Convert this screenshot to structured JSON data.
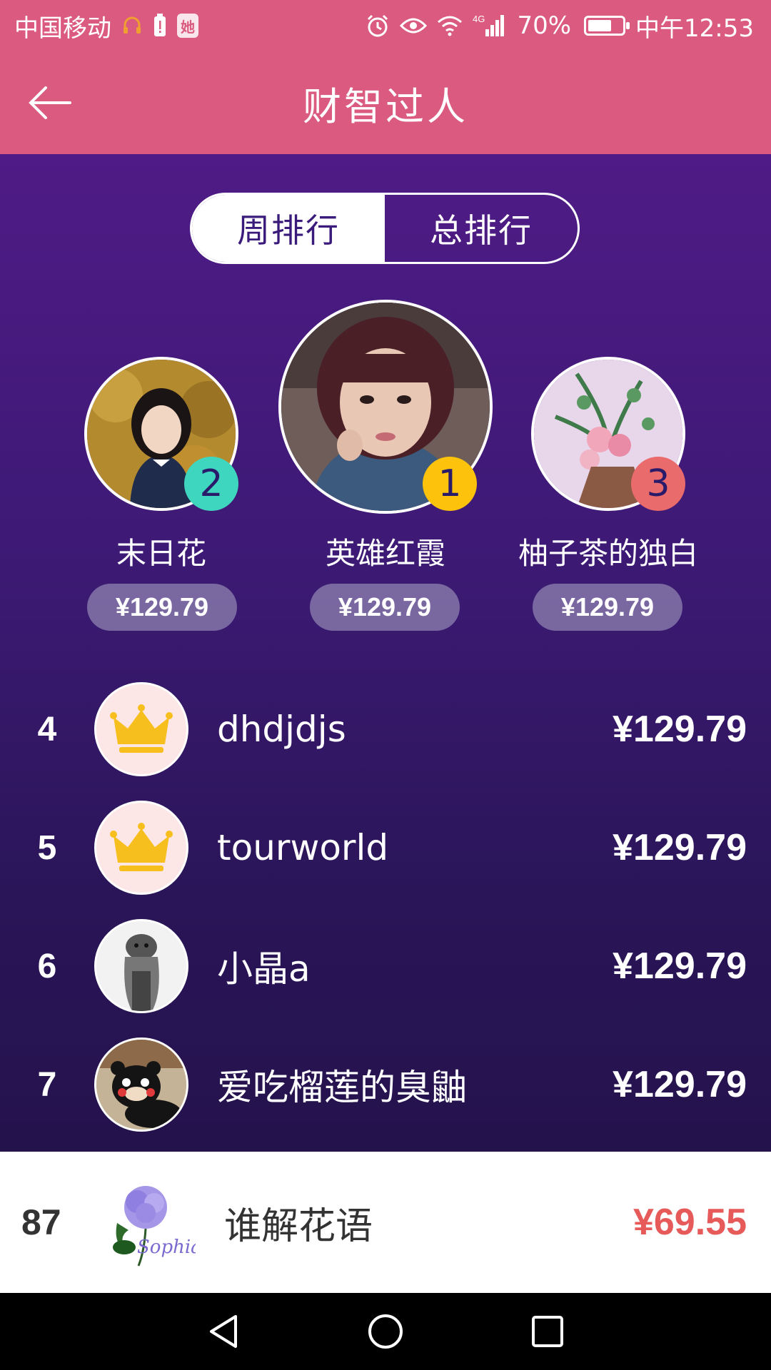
{
  "status_bar": {
    "carrier": "中国移动",
    "network": "4G",
    "battery": "70%",
    "battery_level": 0.7,
    "time": "中午12:53"
  },
  "header": {
    "title": "财智过人"
  },
  "tabs": [
    {
      "label": "周排行",
      "active": true
    },
    {
      "label": "总排行",
      "active": false
    }
  ],
  "podium": [
    {
      "rank": "2",
      "name": "末日花",
      "amount": "¥129.79",
      "badge_color": "#3fd6c0"
    },
    {
      "rank": "1",
      "name": "英雄红霞",
      "amount": "¥129.79",
      "badge_color": "#fcc20c"
    },
    {
      "rank": "3",
      "name": "柚子茶的独白",
      "amount": "¥129.79",
      "badge_color": "#e96b6b"
    }
  ],
  "list": [
    {
      "rank": "4",
      "name": "dhdjdjs",
      "amount": "¥129.79",
      "avatar": "crown-icon"
    },
    {
      "rank": "5",
      "name": "tourworld",
      "amount": "¥129.79",
      "avatar": "crown-icon"
    },
    {
      "rank": "6",
      "name": "小晶a",
      "amount": "¥129.79",
      "avatar": "otter-photo"
    },
    {
      "rank": "7",
      "name": "爱吃榴莲的臭鼬",
      "amount": "¥129.79",
      "avatar": "bear-photo"
    }
  ],
  "my_rank": {
    "rank": "87",
    "name": "谁解花语",
    "amount": "¥69.55",
    "avatar_text": "Sophia"
  },
  "colors": {
    "brand_pink": "#db5a80",
    "panel_purple": "#4f1b86",
    "amount_red": "#e65a5a"
  }
}
